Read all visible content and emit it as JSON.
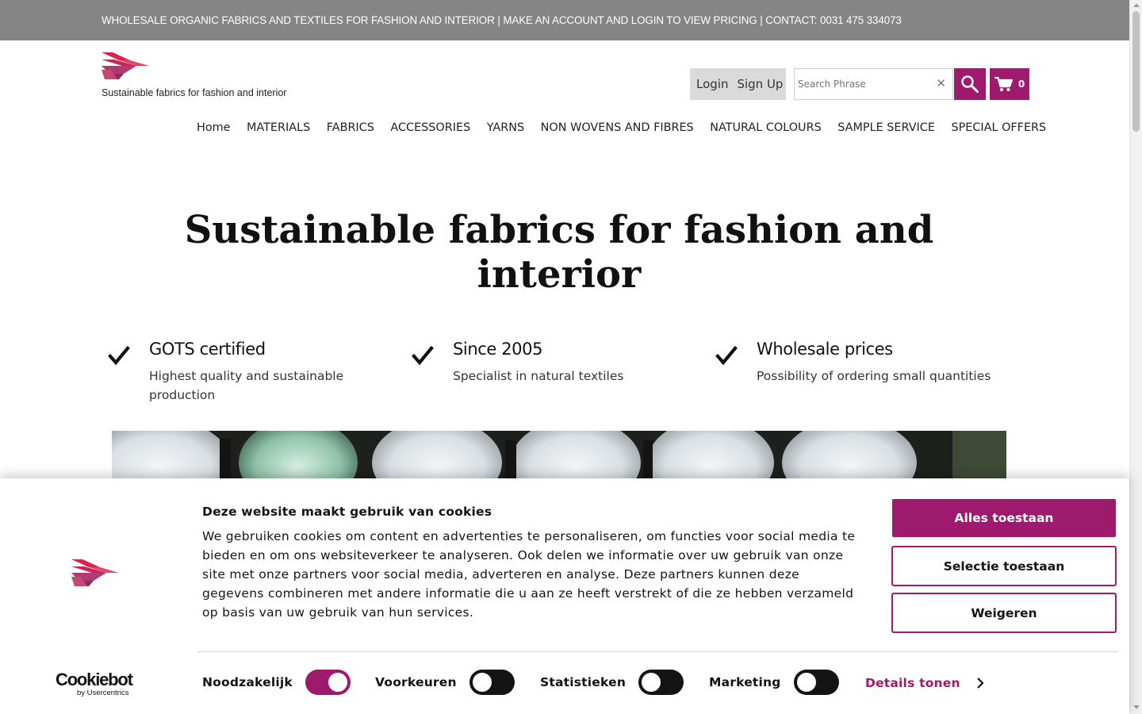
{
  "topbar": {
    "text": "WHOLESALE ORGANIC FABRICS AND TEXTILES FOR FASHION AND INTERIOR | MAKE AN ACCOUNT AND LOGIN TO VIEW PRICING | CONTACT: 0031 475 334073"
  },
  "header": {
    "tagline": "Sustainable fabrics for fashion and interior",
    "login_label": "Login",
    "signup_label": "Sign Up",
    "search_placeholder": "Search Phrase",
    "search_clear": "✕",
    "cart_count": "0"
  },
  "nav": {
    "items": [
      "Home",
      "MATERIALS",
      "FABRICS",
      "ACCESSORIES",
      "YARNS",
      "NON WOVENS AND FIBRES",
      "NATURAL COLOURS",
      "SAMPLE SERVICE",
      "SPECIAL OFFERS"
    ]
  },
  "hero": {
    "title": "Sustainable fabrics for fashion and interior",
    "features": [
      {
        "title": "GOTS certified",
        "desc": "Highest quality and sustainable production"
      },
      {
        "title": "Since 2005",
        "desc": "Specialist in natural textiles"
      },
      {
        "title": "Wholesale prices",
        "desc": "Possibility of ordering small quantities"
      }
    ]
  },
  "cookie": {
    "title": "Deze website maakt gebruik van cookies",
    "text": "We gebruiken cookies om content en advertenties te personaliseren, om functies voor social media te bieden en om ons websiteverkeer te analyseren. Ook delen we informatie over uw gebruik van onze site met onze partners voor social media, adverteren en analyse. Deze partners kunnen deze gegevens combineren met andere informatie die u aan ze heeft verstrekt of die ze hebben verzameld op basis van uw gebruik van hun services.",
    "allow_all": "Alles toestaan",
    "allow_selection": "Selectie toestaan",
    "decline": "Weigeren",
    "brand_name": "Cookiebot",
    "brand_by": "by Usercentrics",
    "categories": [
      {
        "label": "Noodzakelijk",
        "enabled": true
      },
      {
        "label": "Voorkeuren",
        "enabled": false
      },
      {
        "label": "Statistieken",
        "enabled": false
      },
      {
        "label": "Marketing",
        "enabled": false
      }
    ],
    "details_label": "Details tonen"
  },
  "colors": {
    "accent": "#9e1a6d",
    "topbar": "#858585",
    "logo_red": "#d9254e",
    "logo_pink": "#b03a73"
  }
}
